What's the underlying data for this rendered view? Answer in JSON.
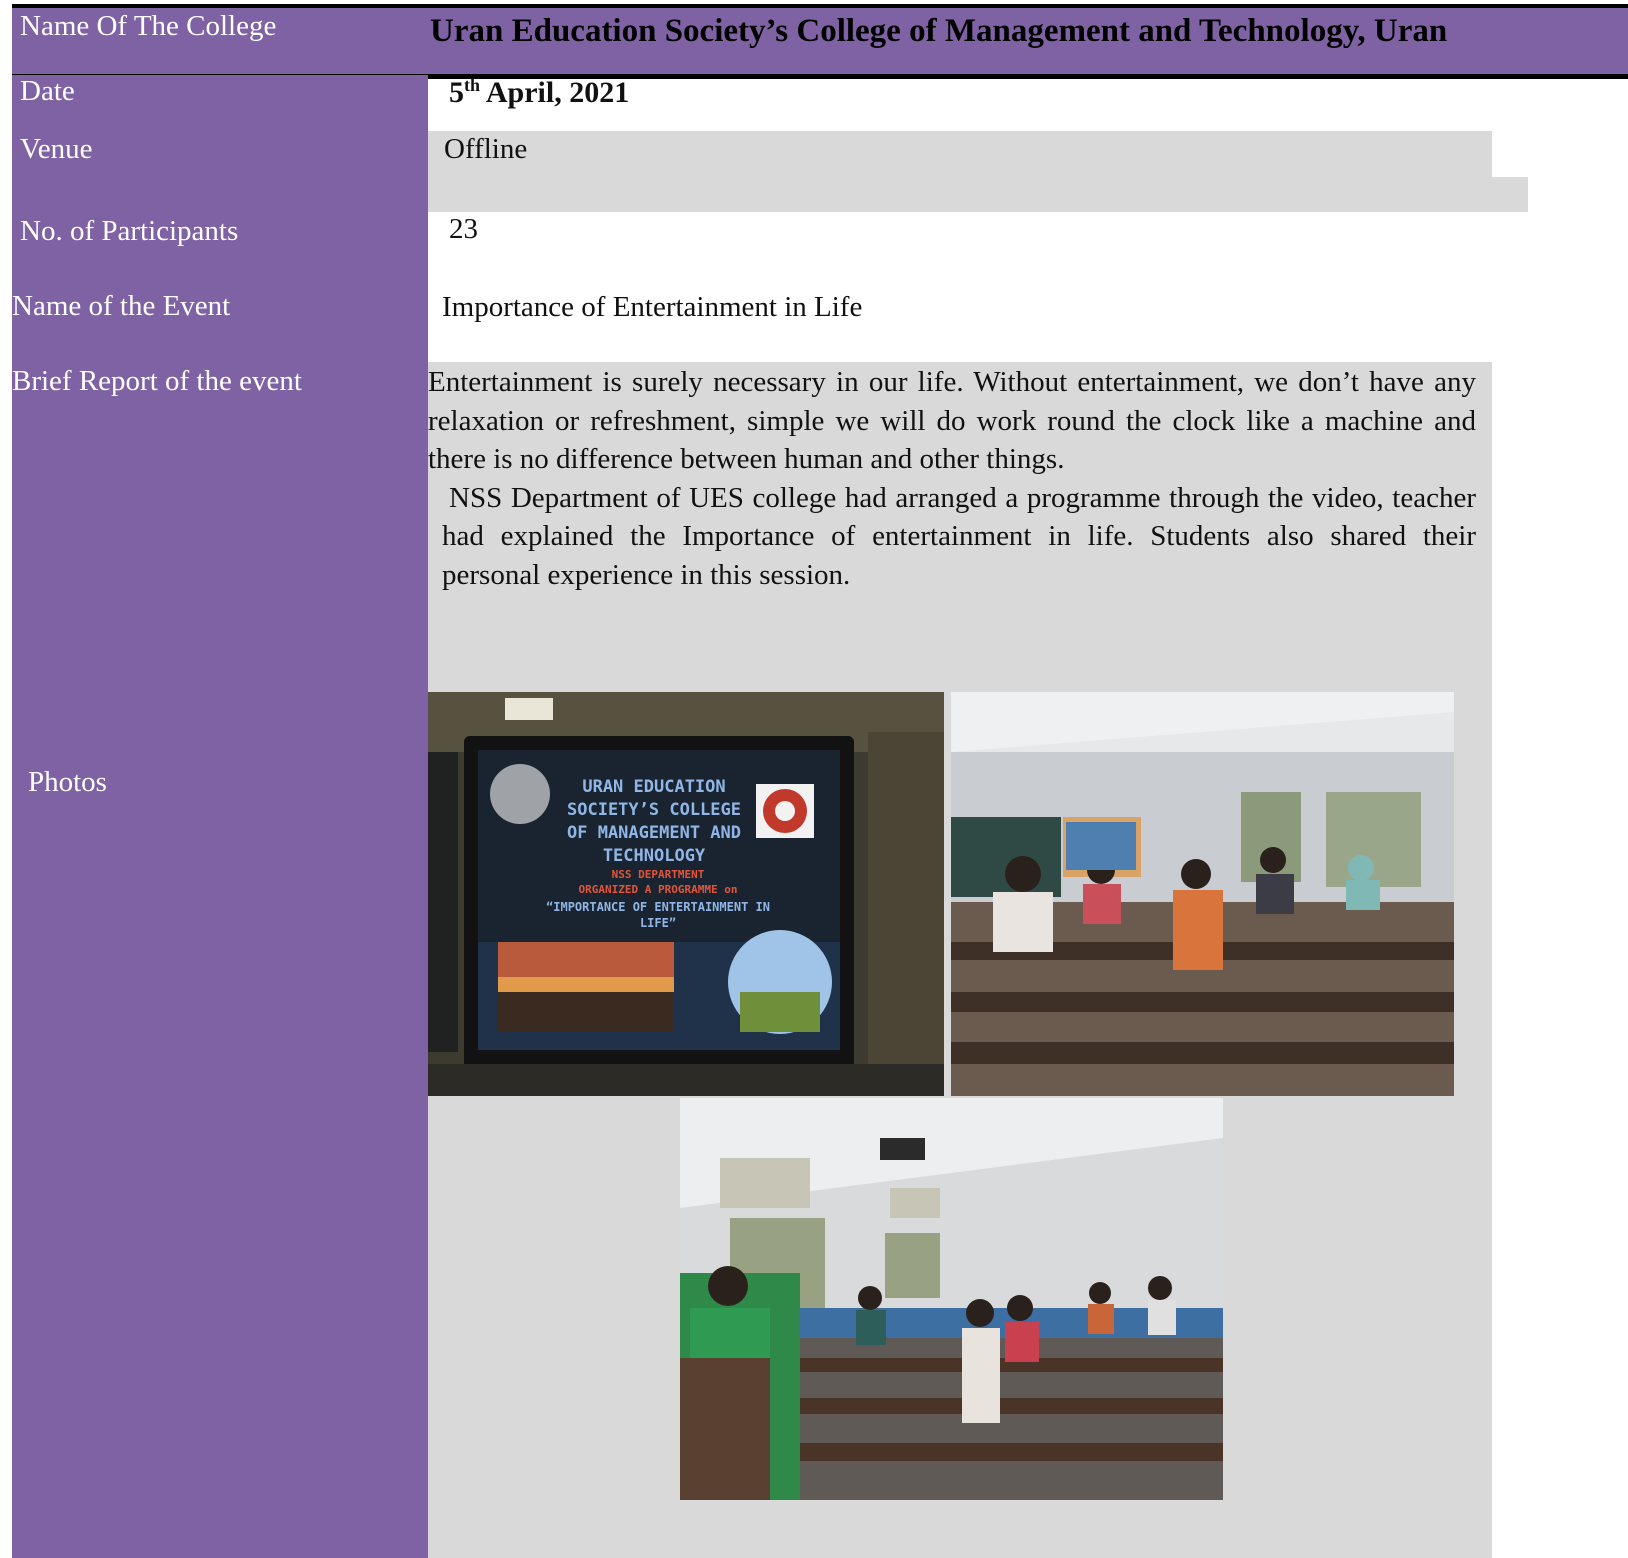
{
  "header": {
    "college_label": "Name Of The College",
    "college_name": "Uran Education Society’s College of  Management and Technology, Uran"
  },
  "rows": {
    "date": {
      "label": "Date",
      "value_main": "5",
      "value_sup": "th",
      "value_rest": " April, 2021"
    },
    "venue": {
      "label": "Venue",
      "value": "Offline"
    },
    "participants": {
      "label": "No. of Participants",
      "value": "23"
    },
    "event": {
      "label": "Name of the Event",
      "value": "Importance of Entertainment in Life"
    },
    "report": {
      "label": "Brief Report of the event",
      "para1": "Entertainment is surely necessary in our life. Without entertainment, we don’t have any relaxation or refreshment, simple we will do work round the clock like a machine and there is no difference between human and other things.",
      "para2": "NSS Department of UES college had arranged a programme through the video, teacher had explained the Importance of entertainment in life. Students also shared their personal experience in this session."
    },
    "photos": {
      "label": "Photos"
    }
  },
  "slide": {
    "line1": "URAN EDUCATION",
    "line2": "SOCIETY’S COLLEGE",
    "line3": "OF MANAGEMENT AND",
    "line4": "TECHNOLOGY",
    "line5": "NSS DEPARTMENT",
    "line6": "ORGANIZED A PROGRAMME on",
    "line7": "“IMPORTANCE OF ENTERTAINMENT IN",
    "line8": "LIFE”"
  },
  "colors": {
    "label_column": "#7f62a3",
    "report_background": "#d9d9d9",
    "slide_title": "#8fb6e6",
    "slide_subtitle": "#e2553b"
  }
}
